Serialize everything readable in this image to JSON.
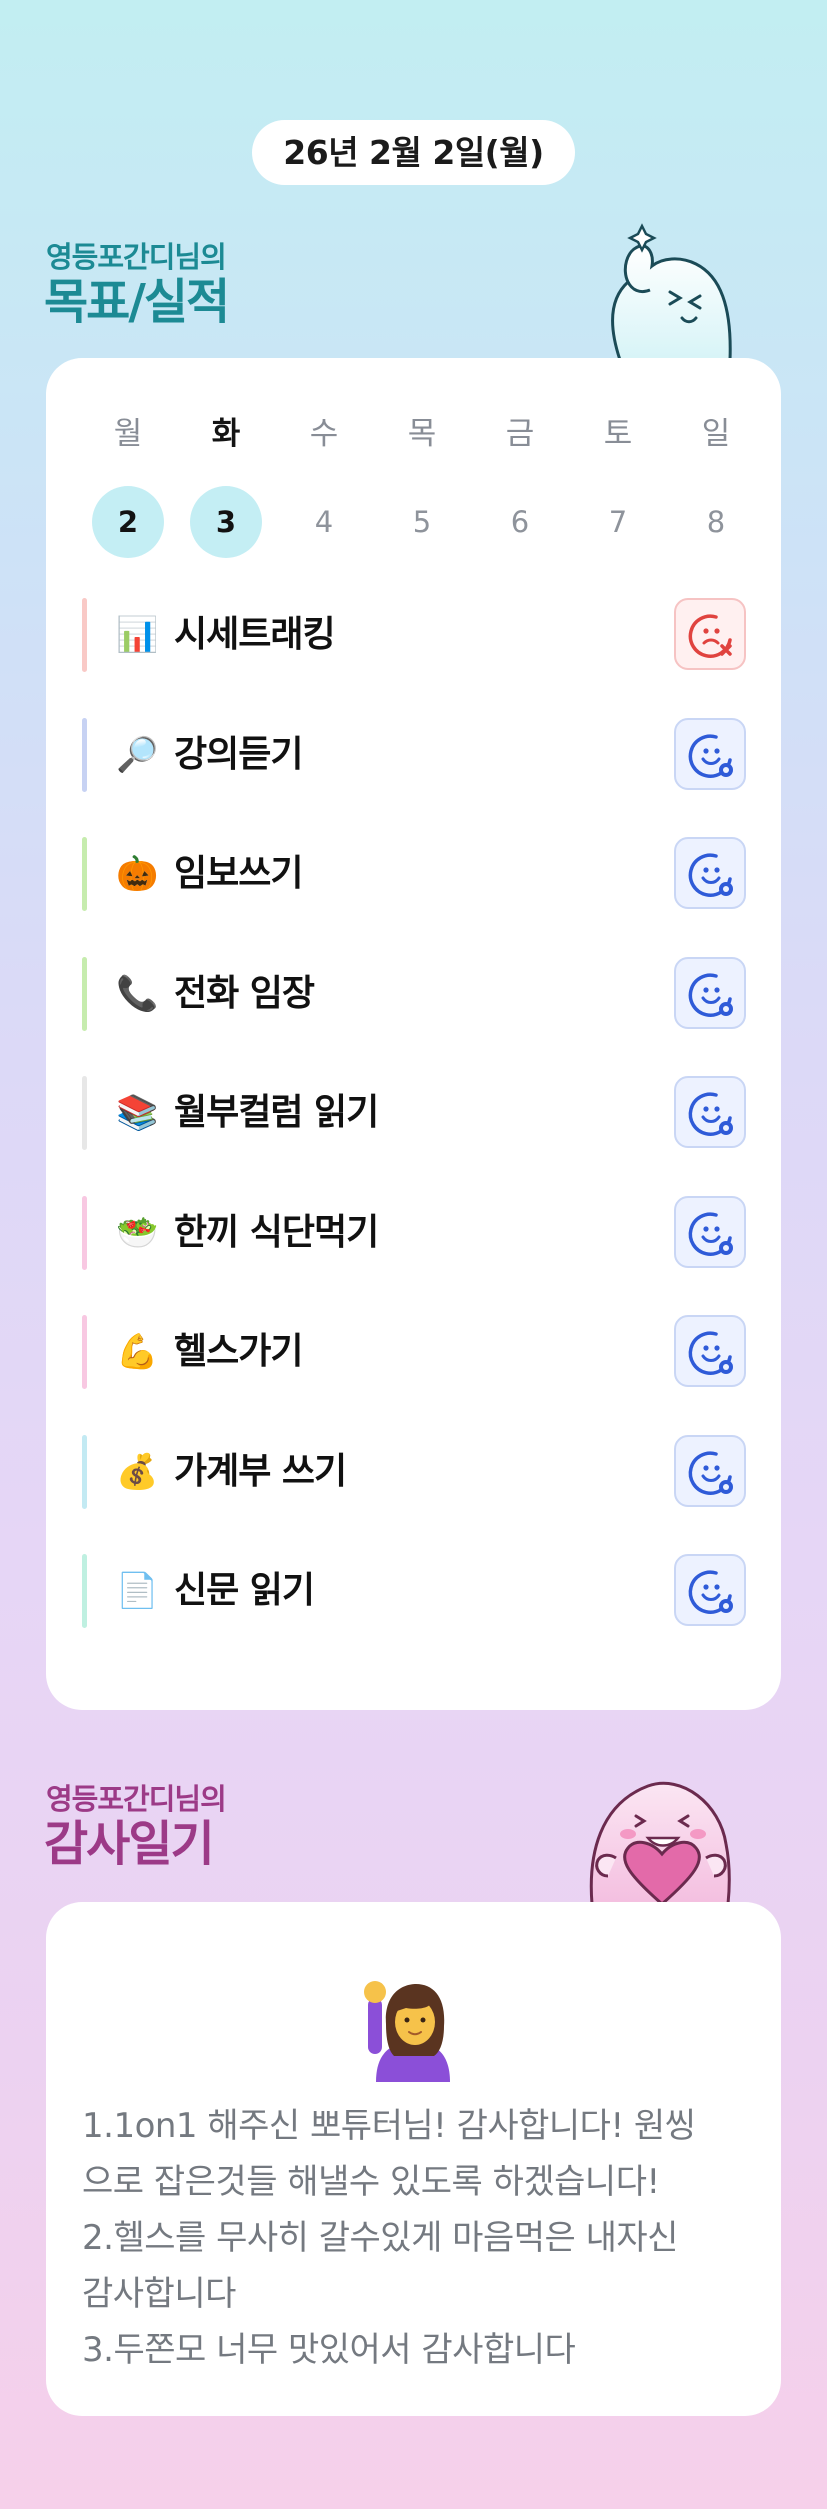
{
  "date_label": "26년 2월 2일(월)",
  "goals_section": {
    "subtitle": "영등포간디님의",
    "title": "목표/실적"
  },
  "week": {
    "days": [
      {
        "name": "월",
        "date": "2",
        "today": false,
        "highlighted": true
      },
      {
        "name": "화",
        "date": "3",
        "today": true,
        "highlighted": true
      },
      {
        "name": "수",
        "date": "4",
        "today": false,
        "highlighted": false
      },
      {
        "name": "목",
        "date": "5",
        "today": false,
        "highlighted": false
      },
      {
        "name": "금",
        "date": "6",
        "today": false,
        "highlighted": false
      },
      {
        "name": "토",
        "date": "7",
        "today": false,
        "highlighted": false
      },
      {
        "name": "일",
        "date": "8",
        "today": false,
        "highlighted": false
      }
    ]
  },
  "goals": [
    {
      "icon": "📊",
      "label": "시세트래킹",
      "accent": "#f9c9c6",
      "status": "fail"
    },
    {
      "icon": "🔎",
      "label": "강의듣기",
      "accent": "#c7d2f3",
      "status": "todo"
    },
    {
      "icon": "🎃",
      "label": "임보쓰기",
      "accent": "#c6ecae",
      "status": "todo"
    },
    {
      "icon": "📞",
      "label": "전화 임장",
      "accent": "#c6ecae",
      "status": "todo"
    },
    {
      "icon": "📚",
      "label": "월부컬럼 읽기",
      "accent": "#e7e7e7",
      "status": "todo"
    },
    {
      "icon": "🥗",
      "label": "한끼 식단먹기",
      "accent": "#f8c8e2",
      "status": "todo"
    },
    {
      "icon": "💪",
      "label": "헬스가기",
      "accent": "#f8c8e2",
      "status": "todo"
    },
    {
      "icon": "💰",
      "label": "가계부 쓰기",
      "accent": "#c3eaf3",
      "status": "todo"
    },
    {
      "icon": "📄",
      "label": "신문 읽기",
      "accent": "#bff0e1",
      "status": "todo"
    }
  ],
  "gratitude_section": {
    "subtitle": "영등포간디님의",
    "title": "감사일기",
    "emoji": "🙋‍♀️",
    "lines": [
      "1.1on1 해주신 뽀튜터님! 감사합니다! 원씽",
      "으로 잡은것들 해낼수 있도록 하겠습니다!",
      "2.헬스를 무사히 갈수있게 마음먹은 내자신",
      "감사합니다",
      "3.두쫀모 너무 맛있어서 감사합니다"
    ]
  },
  "colors": {
    "teal": "#1c8a94",
    "plum": "#9c3a87",
    "status_todo": "#2f5bd8",
    "status_fail": "#e0433f"
  },
  "icons": {
    "status_todo": "smiley-badge-icon",
    "status_fail": "sad-x-icon",
    "mascot_top": "ghost-thumbs-up-icon",
    "mascot_bottom": "pink-ghost-heart-icon"
  }
}
